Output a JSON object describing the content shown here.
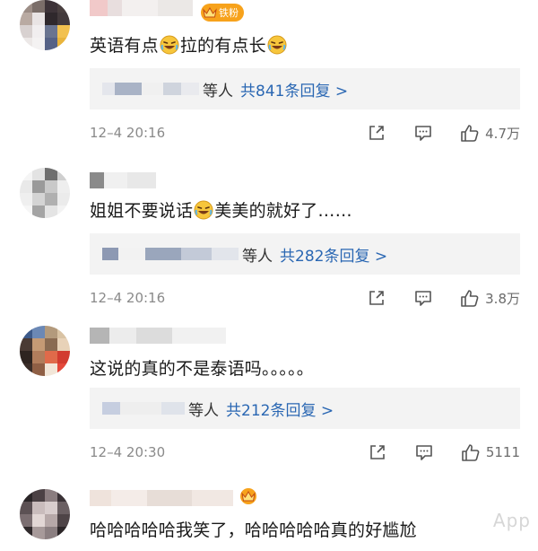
{
  "comments": [
    {
      "text_parts": [
        "英语有点",
        "拉的有点长"
      ],
      "badge": "铁粉",
      "reply_others": "等人",
      "reply_total": "共841条回复 >",
      "time": "12–4 20:16",
      "likes": "4.7万"
    },
    {
      "text_parts": [
        "姐姐不要说话",
        "美美的就好了……"
      ],
      "reply_others": "等人",
      "reply_total": "共282条回复 >",
      "time": "12–4 20:16",
      "likes": "3.8万"
    },
    {
      "text": "这说的真的不是泰语吗。。。。。",
      "reply_others": "等人",
      "reply_total": "共212条回复 >",
      "time": "12–4 20:30",
      "likes": "5111"
    },
    {
      "text": "哈哈哈哈哈我笑了，哈哈哈哈哈真的好尴尬"
    }
  ],
  "watermark": "App",
  "icons": {
    "share": "share-icon",
    "comment": "comment-icon",
    "like": "thumbs-up-icon",
    "crown": "crown-icon",
    "emoji": "laughing-crying-emoji"
  },
  "colors": {
    "badge": "#f7a21b",
    "reply_link": "#2a67b3",
    "reply_bg": "#f3f3f3"
  }
}
